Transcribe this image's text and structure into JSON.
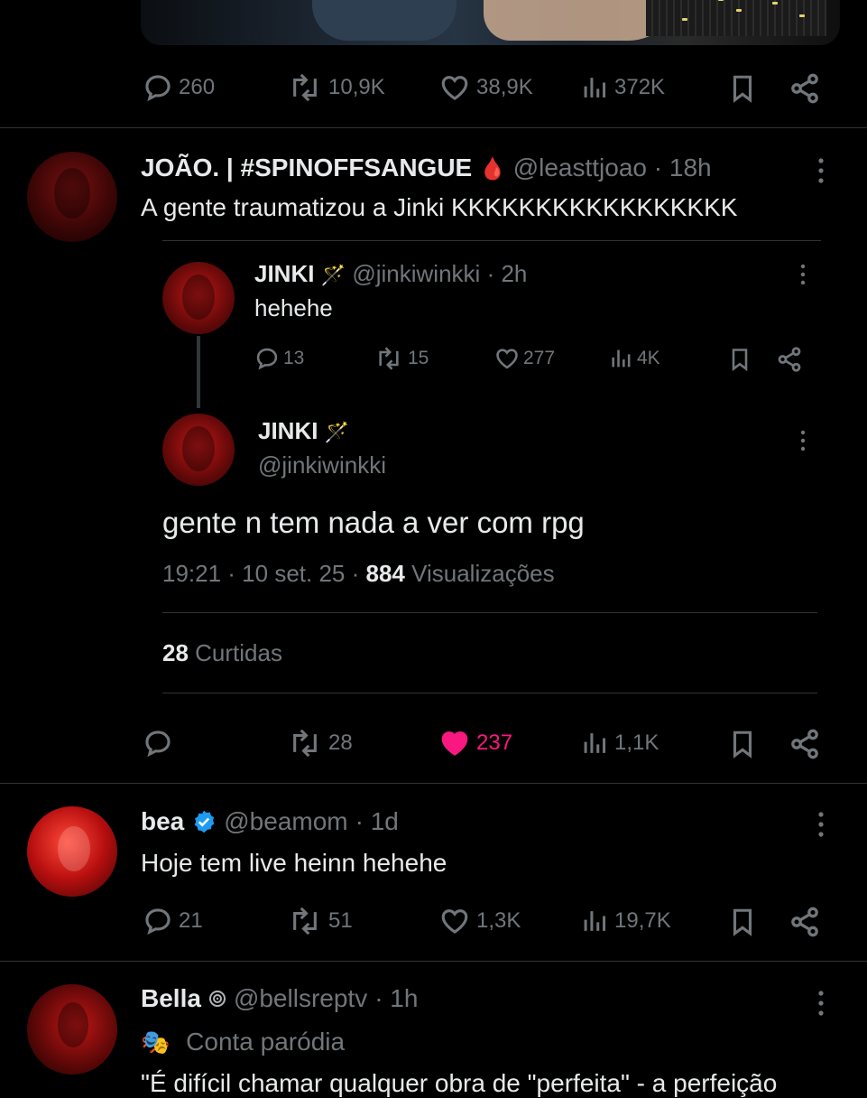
{
  "top_post": {
    "stats": {
      "replies": "260",
      "reposts": "10,9K",
      "likes": "38,9K",
      "views": "372K"
    }
  },
  "reply_joao": {
    "display_name": "JOÃO. | #SPINOFFSANGUE",
    "emoji": "🩸",
    "handle": "@leasttjoao",
    "time": "· 18h",
    "text": "A gente traumatizou a Jinki KKKKKKKKKKKKKKKKK",
    "quoted_thread": {
      "first": {
        "display_name": "JINKI",
        "emoji": "🪄",
        "handle": "@jinkiwinkki",
        "time": "· 2h",
        "text": "hehehe",
        "stats": {
          "replies": "13",
          "reposts": "15",
          "likes": "277",
          "views": "4K"
        }
      },
      "second": {
        "display_name": "JINKI",
        "emoji": "🪄",
        "handle": "@jinkiwinkki",
        "text": "gente n tem nada a ver com rpg",
        "time": "19:21 · 10 set. 25 ·",
        "views_count": "884",
        "views_label": "Visualizações",
        "likes_count": "28",
        "likes_label": "Curtidas"
      }
    },
    "stats": {
      "reposts": "28",
      "likes": "237",
      "views": "1,1K"
    },
    "like_color": "#f91880"
  },
  "reply_bea": {
    "display_name": "bea",
    "verified_color": "#1d9bf0",
    "handle": "@beamom",
    "time": "· 1d",
    "text": "Hoje tem live heinn hehehe",
    "stats": {
      "replies": "21",
      "reposts": "51",
      "likes": "1,3K",
      "views": "19,7K"
    }
  },
  "reply_bella": {
    "display_name": "Bella",
    "handle": "@bellsreptv",
    "time": "· 1h",
    "label_icon": "🎭",
    "label": "Conta paródia",
    "text_partial": "\"É difícil chamar qualquer obra de \"perfeita\" - a perfeição"
  }
}
